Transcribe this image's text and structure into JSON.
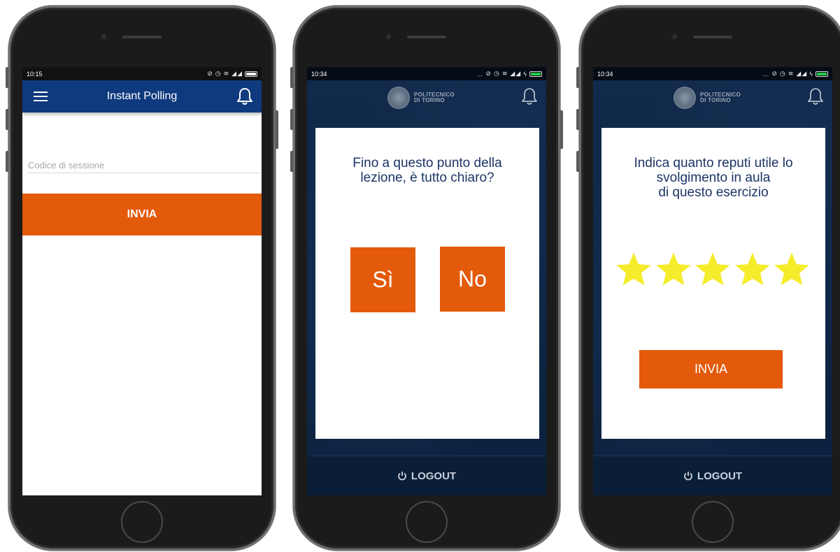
{
  "phone1": {
    "status": {
      "time": "10:15",
      "battery_color": "#ffffff"
    },
    "appbar": {
      "title": "Instant Polling",
      "color": "#0f3a7e"
    },
    "session_field": {
      "placeholder": "Codice di sessione",
      "value": ""
    },
    "submit_label": "INVIA"
  },
  "phone2": {
    "status": {
      "time": "10:34",
      "battery_color": "#22cc44"
    },
    "logo": {
      "line1": "POLITECNICO",
      "line2": "DI TORINO"
    },
    "question": "Fino a questo punto della\nlezione, è tutto chiaro?",
    "answers": {
      "yes": "Sì",
      "no": "No"
    },
    "logout_label": "LOGOUT"
  },
  "phone3": {
    "status": {
      "time": "10:34",
      "battery_color": "#22cc44"
    },
    "logo": {
      "line1": "POLITECNICO",
      "line2": "DI TORINO"
    },
    "question": "Indica quanto reputi utile lo\nsvolgimento in aula\ndi questo esercizio",
    "rating": {
      "stars_total": 5,
      "stars_filled": 5,
      "star_color": "#f5ec2c"
    },
    "submit_label": "INVIA",
    "logout_label": "LOGOUT"
  },
  "colors": {
    "accent": "#e35a0b",
    "navy_text": "#1c3466",
    "dark_bg": "#0e2545"
  }
}
